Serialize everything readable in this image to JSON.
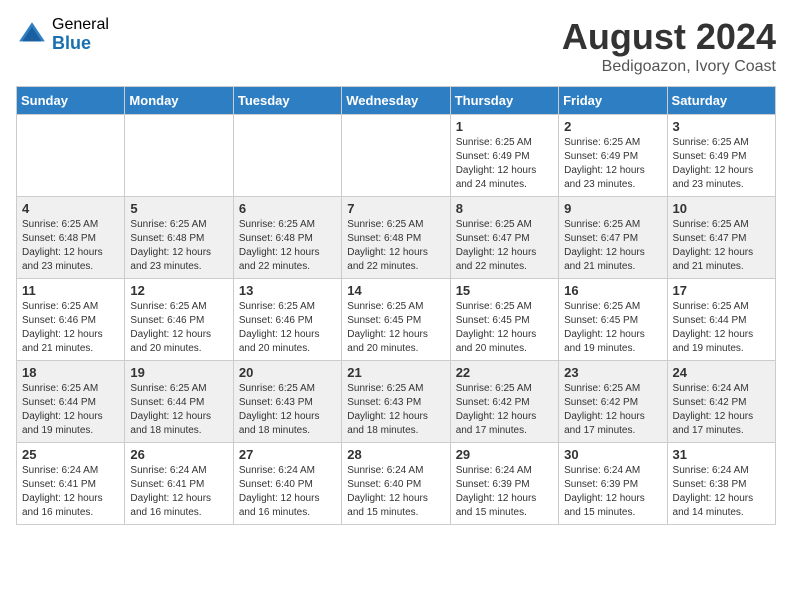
{
  "header": {
    "logo_general": "General",
    "logo_blue": "Blue",
    "month_year": "August 2024",
    "location": "Bedigoazon, Ivory Coast"
  },
  "days_of_week": [
    "Sunday",
    "Monday",
    "Tuesday",
    "Wednesday",
    "Thursday",
    "Friday",
    "Saturday"
  ],
  "weeks": [
    [
      {
        "day": "",
        "info": ""
      },
      {
        "day": "",
        "info": ""
      },
      {
        "day": "",
        "info": ""
      },
      {
        "day": "",
        "info": ""
      },
      {
        "day": "1",
        "info": "Sunrise: 6:25 AM\nSunset: 6:49 PM\nDaylight: 12 hours\nand 24 minutes."
      },
      {
        "day": "2",
        "info": "Sunrise: 6:25 AM\nSunset: 6:49 PM\nDaylight: 12 hours\nand 23 minutes."
      },
      {
        "day": "3",
        "info": "Sunrise: 6:25 AM\nSunset: 6:49 PM\nDaylight: 12 hours\nand 23 minutes."
      }
    ],
    [
      {
        "day": "4",
        "info": "Sunrise: 6:25 AM\nSunset: 6:48 PM\nDaylight: 12 hours\nand 23 minutes."
      },
      {
        "day": "5",
        "info": "Sunrise: 6:25 AM\nSunset: 6:48 PM\nDaylight: 12 hours\nand 23 minutes."
      },
      {
        "day": "6",
        "info": "Sunrise: 6:25 AM\nSunset: 6:48 PM\nDaylight: 12 hours\nand 22 minutes."
      },
      {
        "day": "7",
        "info": "Sunrise: 6:25 AM\nSunset: 6:48 PM\nDaylight: 12 hours\nand 22 minutes."
      },
      {
        "day": "8",
        "info": "Sunrise: 6:25 AM\nSunset: 6:47 PM\nDaylight: 12 hours\nand 22 minutes."
      },
      {
        "day": "9",
        "info": "Sunrise: 6:25 AM\nSunset: 6:47 PM\nDaylight: 12 hours\nand 21 minutes."
      },
      {
        "day": "10",
        "info": "Sunrise: 6:25 AM\nSunset: 6:47 PM\nDaylight: 12 hours\nand 21 minutes."
      }
    ],
    [
      {
        "day": "11",
        "info": "Sunrise: 6:25 AM\nSunset: 6:46 PM\nDaylight: 12 hours\nand 21 minutes."
      },
      {
        "day": "12",
        "info": "Sunrise: 6:25 AM\nSunset: 6:46 PM\nDaylight: 12 hours\nand 20 minutes."
      },
      {
        "day": "13",
        "info": "Sunrise: 6:25 AM\nSunset: 6:46 PM\nDaylight: 12 hours\nand 20 minutes."
      },
      {
        "day": "14",
        "info": "Sunrise: 6:25 AM\nSunset: 6:45 PM\nDaylight: 12 hours\nand 20 minutes."
      },
      {
        "day": "15",
        "info": "Sunrise: 6:25 AM\nSunset: 6:45 PM\nDaylight: 12 hours\nand 20 minutes."
      },
      {
        "day": "16",
        "info": "Sunrise: 6:25 AM\nSunset: 6:45 PM\nDaylight: 12 hours\nand 19 minutes."
      },
      {
        "day": "17",
        "info": "Sunrise: 6:25 AM\nSunset: 6:44 PM\nDaylight: 12 hours\nand 19 minutes."
      }
    ],
    [
      {
        "day": "18",
        "info": "Sunrise: 6:25 AM\nSunset: 6:44 PM\nDaylight: 12 hours\nand 19 minutes."
      },
      {
        "day": "19",
        "info": "Sunrise: 6:25 AM\nSunset: 6:44 PM\nDaylight: 12 hours\nand 18 minutes."
      },
      {
        "day": "20",
        "info": "Sunrise: 6:25 AM\nSunset: 6:43 PM\nDaylight: 12 hours\nand 18 minutes."
      },
      {
        "day": "21",
        "info": "Sunrise: 6:25 AM\nSunset: 6:43 PM\nDaylight: 12 hours\nand 18 minutes."
      },
      {
        "day": "22",
        "info": "Sunrise: 6:25 AM\nSunset: 6:42 PM\nDaylight: 12 hours\nand 17 minutes."
      },
      {
        "day": "23",
        "info": "Sunrise: 6:25 AM\nSunset: 6:42 PM\nDaylight: 12 hours\nand 17 minutes."
      },
      {
        "day": "24",
        "info": "Sunrise: 6:24 AM\nSunset: 6:42 PM\nDaylight: 12 hours\nand 17 minutes."
      }
    ],
    [
      {
        "day": "25",
        "info": "Sunrise: 6:24 AM\nSunset: 6:41 PM\nDaylight: 12 hours\nand 16 minutes."
      },
      {
        "day": "26",
        "info": "Sunrise: 6:24 AM\nSunset: 6:41 PM\nDaylight: 12 hours\nand 16 minutes."
      },
      {
        "day": "27",
        "info": "Sunrise: 6:24 AM\nSunset: 6:40 PM\nDaylight: 12 hours\nand 16 minutes."
      },
      {
        "day": "28",
        "info": "Sunrise: 6:24 AM\nSunset: 6:40 PM\nDaylight: 12 hours\nand 15 minutes."
      },
      {
        "day": "29",
        "info": "Sunrise: 6:24 AM\nSunset: 6:39 PM\nDaylight: 12 hours\nand 15 minutes."
      },
      {
        "day": "30",
        "info": "Sunrise: 6:24 AM\nSunset: 6:39 PM\nDaylight: 12 hours\nand 15 minutes."
      },
      {
        "day": "31",
        "info": "Sunrise: 6:24 AM\nSunset: 6:38 PM\nDaylight: 12 hours\nand 14 minutes."
      }
    ]
  ]
}
